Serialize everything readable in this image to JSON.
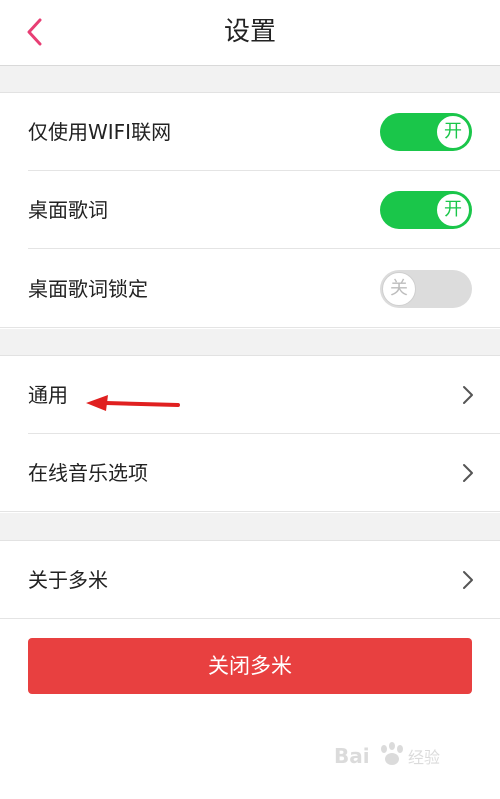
{
  "header": {
    "title": "设置",
    "back_icon": "chevron-left-icon"
  },
  "toggles": [
    {
      "label": "仅使用WIFI联网",
      "state_text": "开",
      "on": true
    },
    {
      "label": "桌面歌词",
      "state_text": "开",
      "on": true
    },
    {
      "label": "桌面歌词锁定",
      "state_text": "关",
      "on": false
    }
  ],
  "nav_items": [
    {
      "label": "通用",
      "icon": "chevron-right-icon"
    },
    {
      "label": "在线音乐选项",
      "icon": "chevron-right-icon"
    },
    {
      "label": "关于多米",
      "icon": "chevron-right-icon"
    }
  ],
  "close_button": {
    "label": "关闭多米"
  },
  "colors": {
    "accent_pink": "#e83e74",
    "toggle_on": "#1ac64a",
    "toggle_off": "#dcdcdc",
    "close_red": "#e84040",
    "annotation_red": "#e02020"
  },
  "watermark": {
    "text": "Baidu 经验",
    "icon": "baidu-paw-icon"
  }
}
